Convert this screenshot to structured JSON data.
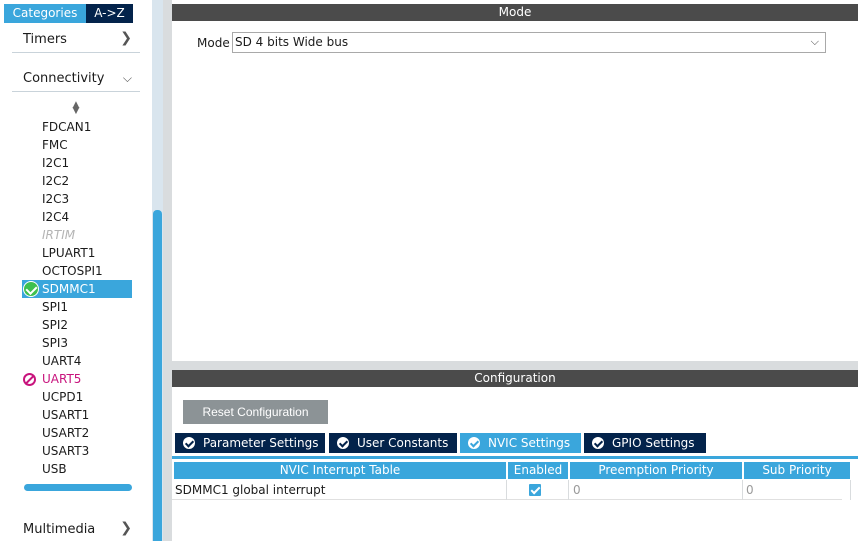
{
  "sidebar": {
    "tabs": [
      {
        "label": "Categories",
        "active": true
      },
      {
        "label": "A->Z",
        "active": false
      }
    ],
    "categories": [
      {
        "label": "Timers",
        "chevron": "chevron-right-icon"
      },
      {
        "label": "Connectivity",
        "chevron": "chevron-down-icon"
      },
      {
        "label": "Multimedia",
        "chevron": "chevron-right-icon"
      }
    ],
    "peripherals": [
      {
        "label": "FDCAN1",
        "state": "normal"
      },
      {
        "label": "FMC",
        "state": "normal"
      },
      {
        "label": "I2C1",
        "state": "normal"
      },
      {
        "label": "I2C2",
        "state": "normal"
      },
      {
        "label": "I2C3",
        "state": "normal"
      },
      {
        "label": "I2C4",
        "state": "normal"
      },
      {
        "label": "IRTIM",
        "state": "disabled"
      },
      {
        "label": "LPUART1",
        "state": "normal"
      },
      {
        "label": "OCTOSPI1",
        "state": "normal"
      },
      {
        "label": "SDMMC1",
        "state": "selected"
      },
      {
        "label": "SPI1",
        "state": "normal"
      },
      {
        "label": "SPI2",
        "state": "normal"
      },
      {
        "label": "SPI3",
        "state": "normal"
      },
      {
        "label": "UART4",
        "state": "normal"
      },
      {
        "label": "UART5",
        "state": "error"
      },
      {
        "label": "UCPD1",
        "state": "normal"
      },
      {
        "label": "USART1",
        "state": "normal"
      },
      {
        "label": "USART2",
        "state": "normal"
      },
      {
        "label": "USART3",
        "state": "normal"
      },
      {
        "label": "USB",
        "state": "normal"
      }
    ]
  },
  "mode": {
    "header": "Mode",
    "label": "Mode",
    "value": "SD 4 bits Wide bus"
  },
  "configuration": {
    "header": "Configuration",
    "reset_label": "Reset Configuration",
    "tabs": [
      {
        "label": "Parameter Settings",
        "active": false
      },
      {
        "label": "User Constants",
        "active": false
      },
      {
        "label": "NVIC Settings",
        "active": true
      },
      {
        "label": "GPIO Settings",
        "active": false
      }
    ],
    "table": {
      "headers": [
        "NVIC Interrupt Table",
        "Enabled",
        "Preemption Priority",
        "Sub Priority"
      ],
      "rows": [
        {
          "name": "SDMMC1 global interrupt",
          "enabled": true,
          "preemption": "0",
          "sub": "0"
        }
      ]
    }
  },
  "colors": {
    "accent": "#3aa6dc",
    "navy": "#03234b",
    "header_grey": "#4b4b4b",
    "error": "#c8147d",
    "ok": "#3ec050"
  }
}
